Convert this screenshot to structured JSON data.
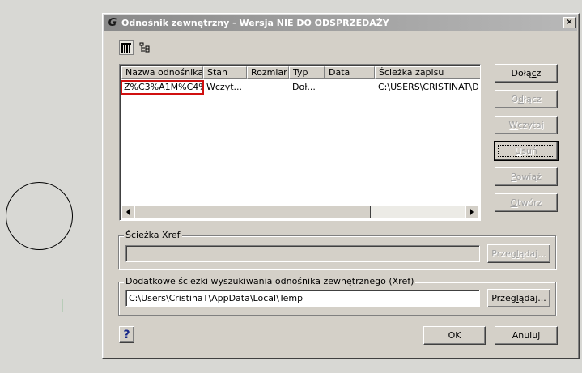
{
  "dialog": {
    "title": "Odnośnik zewnętrzny - Wersja NIE DO ODSPRZEDAŻY",
    "app_icon": "G",
    "close_label": "×"
  },
  "list": {
    "columns": [
      "Nazwa odnośnika",
      "Stan",
      "Rozmiar",
      "Typ",
      "Data",
      "Ścieżka zapisu"
    ],
    "rows": [
      {
        "name": "Z%C3%A1M%C4%9",
        "status": "Wczyt...",
        "size": "",
        "type": "Doł...",
        "date": "",
        "path": "C:\\USERS\\CRISTINAT\\D"
      }
    ]
  },
  "buttons": {
    "attach_pre": "Dołą",
    "attach_ul": "c",
    "attach_post": "z",
    "detach_pre": "O",
    "detach_ul": "d",
    "detach_post": "łącz",
    "reload_pre": "",
    "reload_ul": "W",
    "reload_post": "czytaj",
    "unload_pre": "",
    "unload_ul": "U",
    "unload_post": "suń",
    "bind_pre": "",
    "bind_ul": "P",
    "bind_post": "owiąż",
    "open_pre": "",
    "open_ul": "O",
    "open_post": "twórz"
  },
  "xref_path": {
    "label_pre": "",
    "label_ul": "Ś",
    "label_post": "cieżka Xref",
    "value": "",
    "browse_pre": "Przeg",
    "browse_ul": "l",
    "browse_post": "ądaj..."
  },
  "search_paths": {
    "label": "Dodatkowe ścieżki wyszukiwania odnośnika zewnętrznego (Xref)",
    "value": "C:\\Users\\CristinaT\\AppData\\Local\\Temp",
    "browse_pre": "Przeg",
    "browse_ul": "l",
    "browse_post": "ądaj..."
  },
  "footer": {
    "help_label": "?",
    "ok_label": "OK",
    "cancel_label": "Anuluj"
  }
}
